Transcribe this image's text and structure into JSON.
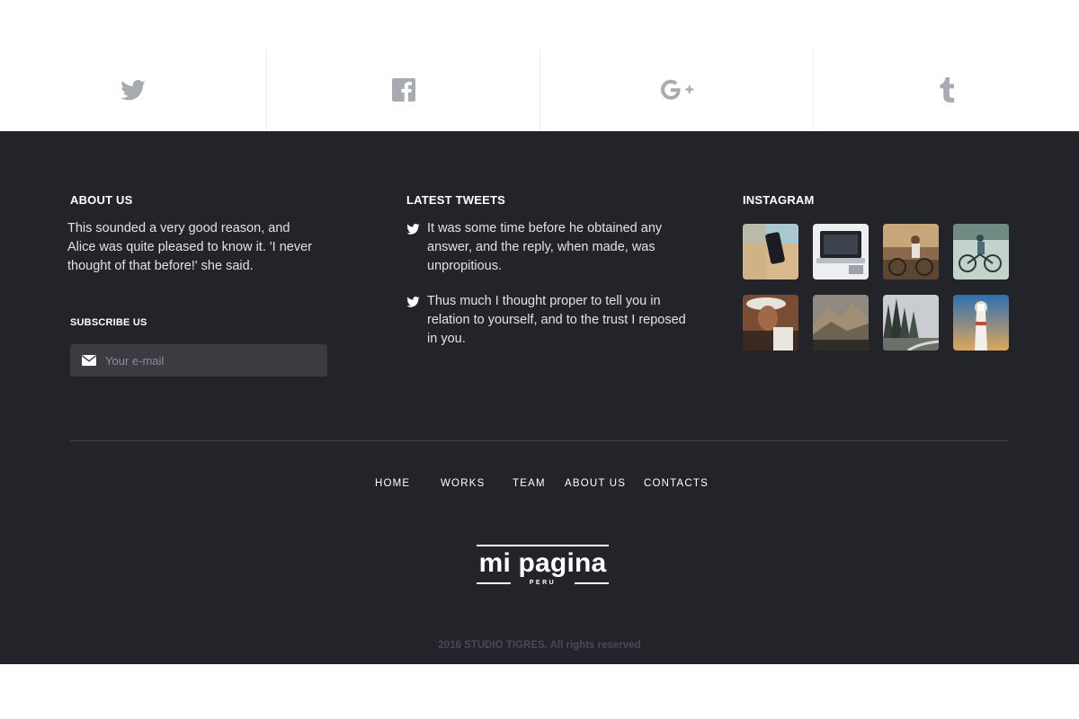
{
  "social": {
    "items": [
      {
        "name": "twitter",
        "icon": "twitter-icon"
      },
      {
        "name": "facebook",
        "icon": "facebook-icon"
      },
      {
        "name": "google-plus",
        "icon": "google-plus-icon"
      },
      {
        "name": "tumblr",
        "icon": "tumblr-icon"
      }
    ],
    "icon_color": "#a9abb3"
  },
  "about": {
    "heading": "ABOUT US",
    "text": "This sounded a very good reason, and Alice was quite pleased to know it. 'I never thought of that before!' she said."
  },
  "subscribe": {
    "heading": "SUBSCRIBE US",
    "placeholder": "Your e-mail",
    "icon": "envelope-icon"
  },
  "tweets": {
    "heading": "LATEST TWEETS",
    "items": [
      {
        "text": "It was some time before he obtained any answer, and the reply, when made, was unpropitious."
      },
      {
        "text": "Thus much I thought proper to tell you in relation to yourself, and to the trust I reposed in you."
      }
    ]
  },
  "instagram": {
    "heading": "INSTAGRAM",
    "photos": [
      "phone on desk",
      "laptop",
      "cyclist woman",
      "bicycle rider",
      "woman with hat",
      "mountains",
      "forest road",
      "lighthouse"
    ]
  },
  "nav": {
    "items": [
      "HOME",
      "WORKS",
      "TEAM",
      "ABOUT US",
      "CONTACTS"
    ]
  },
  "logo": {
    "name": "mi pagina",
    "sub": "PERU"
  },
  "copyright": "2016 STUDIO TIGRES. All rights reserved",
  "colors": {
    "footer_bg": "#232429",
    "input_bg": "#3b3c42",
    "copyright": "#4a4b52"
  }
}
